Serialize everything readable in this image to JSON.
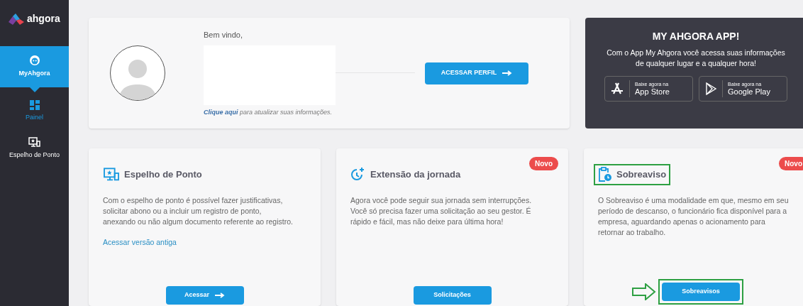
{
  "sidebar": {
    "logo": "ahgora",
    "items": [
      {
        "label": "MyAhgora",
        "selected": true,
        "current": false
      },
      {
        "label": "Painel",
        "selected": false,
        "current": true
      },
      {
        "label": "Espelho de Ponto",
        "selected": false,
        "current": false
      }
    ]
  },
  "profile": {
    "greeting": "Bem vindo,",
    "link": "Clique aqui",
    "link_rest": "para atualizar suas informações.",
    "button": "ACESSAR PERFIL"
  },
  "app_promo": {
    "title": "MY AHGORA APP!",
    "text": "Com o App My Ahgora você acessa suas informações de qualquer lugar e a qualquer hora!",
    "stores": [
      {
        "kind": "apple",
        "small": "Baixe agora na",
        "name": "App Store"
      },
      {
        "kind": "google",
        "small": "Baixe agora na",
        "name": "Google Play"
      }
    ]
  },
  "cards": [
    {
      "title": "Espelho de Ponto",
      "text": "Com o espelho de ponto é possível fazer justificativas, solicitar abono ou a incluir um registro de ponto, anexando ou não algum documento referente ao registro.",
      "link": "Acessar versão antiga",
      "button": "Acessar",
      "button_arrow": true,
      "highlighted": false
    },
    {
      "title": "Extensão da jornada",
      "badge": "Novo",
      "text": "Agora você pode seguir sua jornada sem interrupções. Você só precisa fazer uma solicitação ao seu gestor. É rápido e fácil, mas não deixe para última hora!",
      "button": "Solicitações",
      "button_arrow": false,
      "highlighted": false
    },
    {
      "title": "Sobreaviso",
      "badge": "Novo",
      "text": "O Sobreaviso é uma modalidade em que, mesmo em seu período de descanso, o funcionário fica disponível para a empresa, aguardando apenas o acionamento para retornar ao trabalho.",
      "button": "Sobreavisos",
      "button_arrow": false,
      "highlighted": true
    }
  ]
}
